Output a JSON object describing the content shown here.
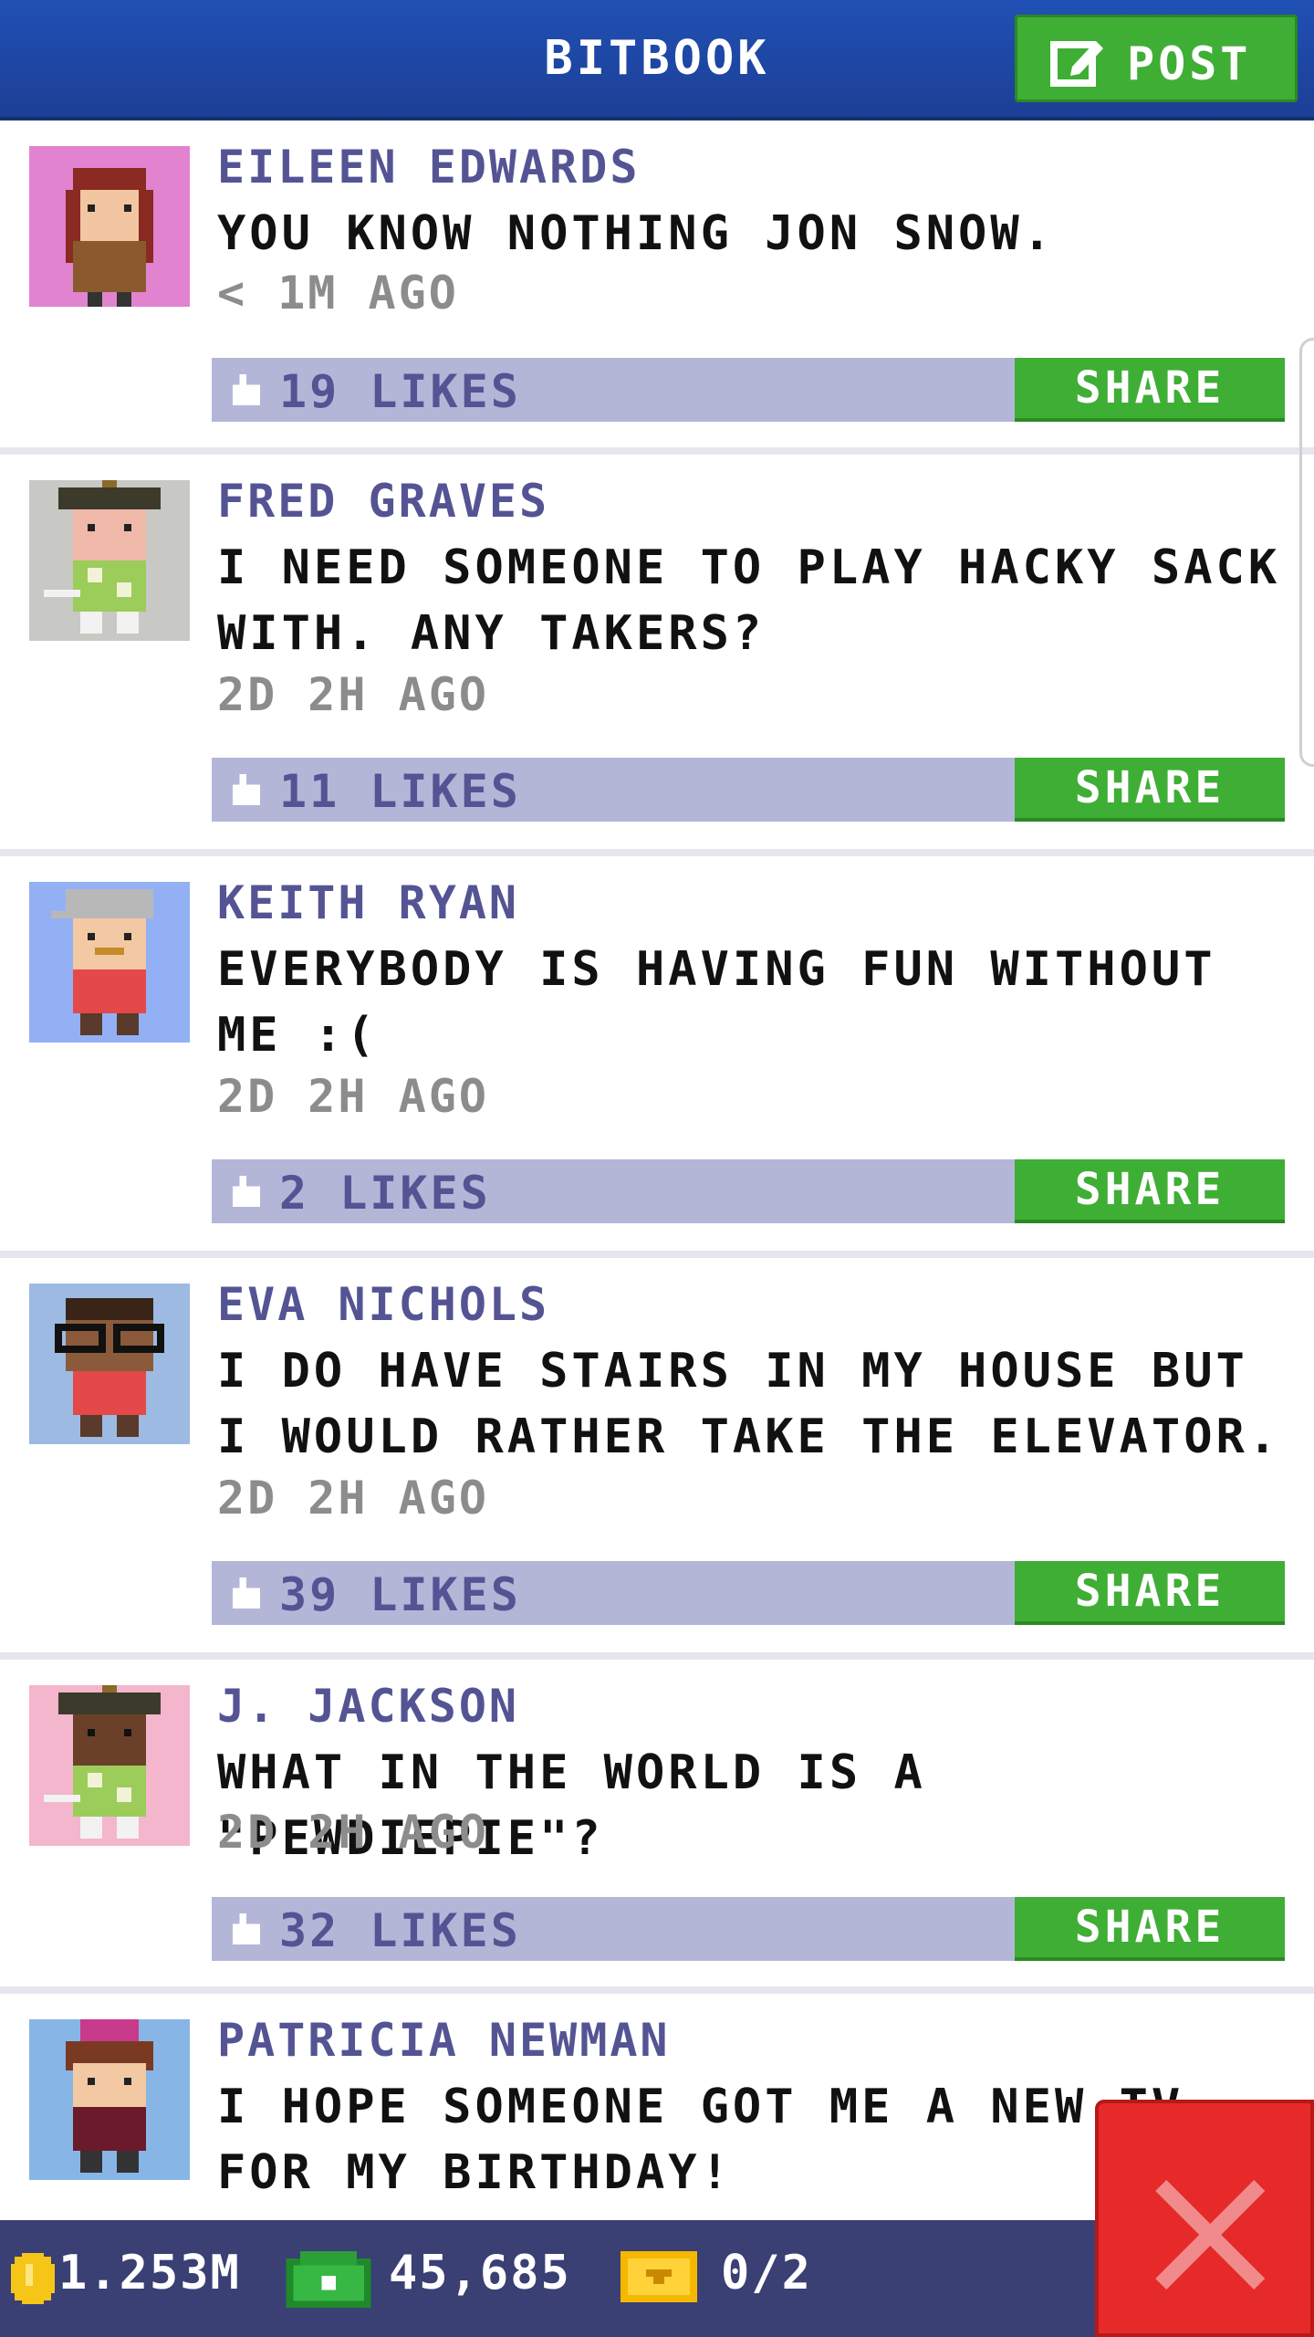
{
  "header": {
    "title": "BITBOOK",
    "post_label": "POST"
  },
  "posts": [
    {
      "author": "EILEEN EDWARDS",
      "message": "YOU KNOW NOTHING JON SNOW.",
      "time": "< 1M AGO",
      "likes": "19 LIKES",
      "share_label": "SHARE",
      "avatar_bg": "#e283cf"
    },
    {
      "author": "FRED GRAVES",
      "message": "I NEED SOMEONE TO PLAY HACKY SACK WITH. ANY TAKERS?",
      "time": "2D 2H AGO",
      "likes": "11 LIKES",
      "share_label": "SHARE",
      "avatar_bg": "#c8c8c4"
    },
    {
      "author": "KEITH RYAN",
      "message": "EVERYBODY IS HAVING FUN WITHOUT ME :(",
      "time": "2D 2H AGO",
      "likes": "2 LIKES",
      "share_label": "SHARE",
      "avatar_bg": "#93b0f5"
    },
    {
      "author": "EVA NICHOLS",
      "message": "I DO HAVE STAIRS IN MY HOUSE BUT I WOULD RATHER TAKE THE ELEVATOR.",
      "time": "2D 2H AGO",
      "likes": "39 LIKES",
      "share_label": "SHARE",
      "avatar_bg": "#9dbbe2"
    },
    {
      "author": "J. JACKSON",
      "message": "WHAT IN THE WORLD IS A \"PEWDIEPIE\"?",
      "time": "2D 2H AGO",
      "likes": "32 LIKES",
      "share_label": "SHARE",
      "avatar_bg": "#f3b6cc"
    },
    {
      "author": "PATRICIA NEWMAN",
      "message": "I HOPE SOMEONE GOT ME A NEW TV FOR MY BIRTHDAY!",
      "time": "",
      "likes": "",
      "share_label": "",
      "avatar_bg": "#87b6e6"
    }
  ],
  "footer": {
    "coins": "1.253M",
    "bux": "45,685",
    "tickets": "0/2"
  },
  "colors": {
    "header_blue": "#2050b4",
    "accent_green": "#3fae35",
    "likes_bar": "#b4b6d8",
    "author_text": "#545494",
    "footer_bg": "#3a3f74",
    "close_red": "#e62a2a"
  }
}
